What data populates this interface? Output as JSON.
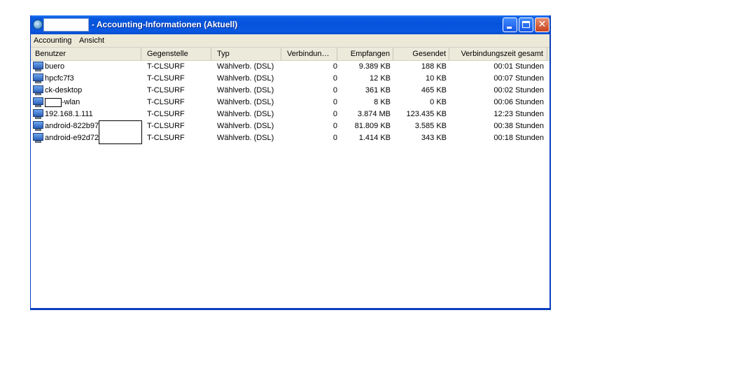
{
  "window": {
    "title": "- Accounting-Informationen (Aktuell)",
    "close_glyph": "✕"
  },
  "menu": [
    "Accounting",
    "Ansicht"
  ],
  "columns": [
    "Benutzer",
    "Gegenstelle",
    "Typ",
    "Verbindun…",
    "Empfangen",
    "Gesendet",
    "Verbindungszeit gesamt"
  ],
  "rows": [
    {
      "user_prefix": "",
      "user": "buero",
      "peer": "T-CLSURF",
      "type": "Wählverb. (DSL)",
      "connections": "0",
      "received": "9.389 KB",
      "sent": "188 KB",
      "time": "00:01 Stunden",
      "redact": ""
    },
    {
      "user_prefix": "",
      "user": "hpcfc7f3",
      "peer": "T-CLSURF",
      "type": "Wählverb. (DSL)",
      "connections": "0",
      "received": "12 KB",
      "sent": "10 KB",
      "time": "00:07 Stunden",
      "redact": ""
    },
    {
      "user_prefix": "",
      "user": "ck-desktop",
      "peer": "T-CLSURF",
      "type": "Wählverb. (DSL)",
      "connections": "0",
      "received": "361 KB",
      "sent": "465 KB",
      "time": "00:02 Stunden",
      "redact": ""
    },
    {
      "user_prefix": "",
      "user": "-wlan",
      "peer": "T-CLSURF",
      "type": "Wählverb. (DSL)",
      "connections": "0",
      "received": "8 KB",
      "sent": "0 KB",
      "time": "00:06 Stunden",
      "redact": "small"
    },
    {
      "user_prefix": "",
      "user": "192.168.1.111",
      "peer": "T-CLSURF",
      "type": "Wählverb. (DSL)",
      "connections": "0",
      "received": "3.874 MB",
      "sent": "123.435 KB",
      "time": "12:23 Stunden",
      "redact": ""
    },
    {
      "user_prefix": "android-822b97",
      "user": "",
      "peer": "T-CLSURF",
      "type": "Wählverb. (DSL)",
      "connections": "0",
      "received": "81.809 KB",
      "sent": "3.585 KB",
      "time": "00:38 Stunden",
      "redact": "big"
    },
    {
      "user_prefix": "android-e92d72",
      "user": "",
      "peer": "T-CLSURF",
      "type": "Wählverb. (DSL)",
      "connections": "0",
      "received": "1.414 KB",
      "sent": "343 KB",
      "time": "00:18 Stunden",
      "redact": ""
    }
  ]
}
